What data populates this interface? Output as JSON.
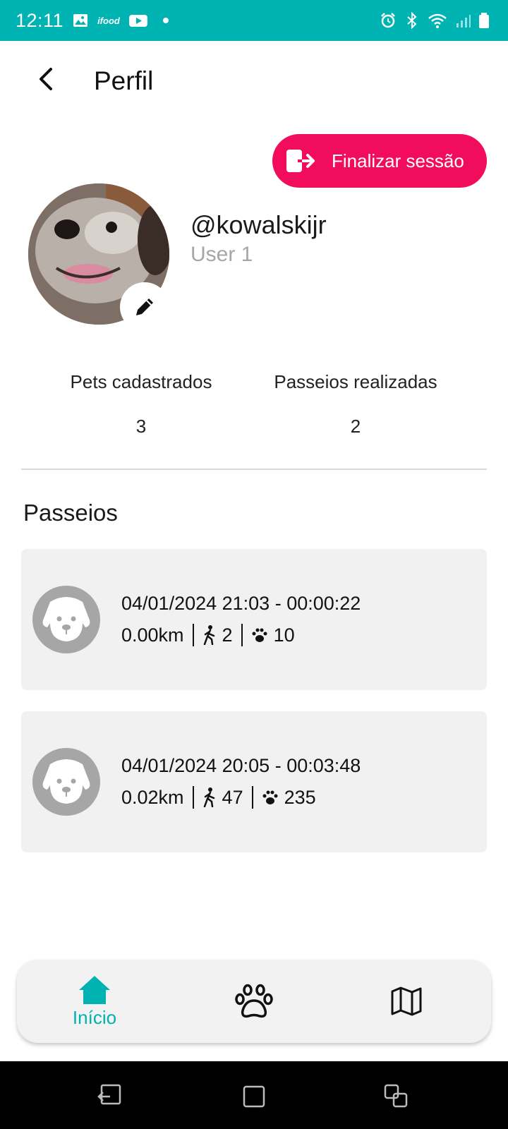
{
  "status_bar": {
    "time": "12:11",
    "left_icons": [
      "gallery-icon",
      "ifood-icon",
      "youtube-icon",
      "dot-icon"
    ],
    "right_icons": [
      "alarm-icon",
      "bluetooth-icon",
      "wifi-icon",
      "signal-icon",
      "battery-icon"
    ],
    "ifood_text": "ifood"
  },
  "header": {
    "title": "Perfil"
  },
  "logout": {
    "label": "Finalizar sessão"
  },
  "profile": {
    "username": "@kowalskijr",
    "user_label": "User 1"
  },
  "stats": [
    {
      "label": "Pets cadastrados",
      "value": "3"
    },
    {
      "label": "Passeios realizadas",
      "value": "2"
    }
  ],
  "walks_section": {
    "title": "Passeios"
  },
  "walks": [
    {
      "title": "04/01/2024 21:03 - 00:00:22",
      "distance": "0.00km",
      "steps": "2",
      "paws": "10"
    },
    {
      "title": "04/01/2024 20:05 - 00:03:48",
      "distance": "0.02km",
      "steps": "47",
      "paws": "235"
    }
  ],
  "bottom_nav": {
    "items": [
      {
        "label": "Início",
        "icon": "home-icon",
        "active": true
      },
      {
        "label": "",
        "icon": "paw-icon",
        "active": false
      },
      {
        "label": "",
        "icon": "map-icon",
        "active": false
      }
    ]
  },
  "colors": {
    "accent": "#00b3b3",
    "logout": "#f10c5c",
    "card_bg": "#f1f1f1",
    "muted": "#a6a6a6"
  }
}
